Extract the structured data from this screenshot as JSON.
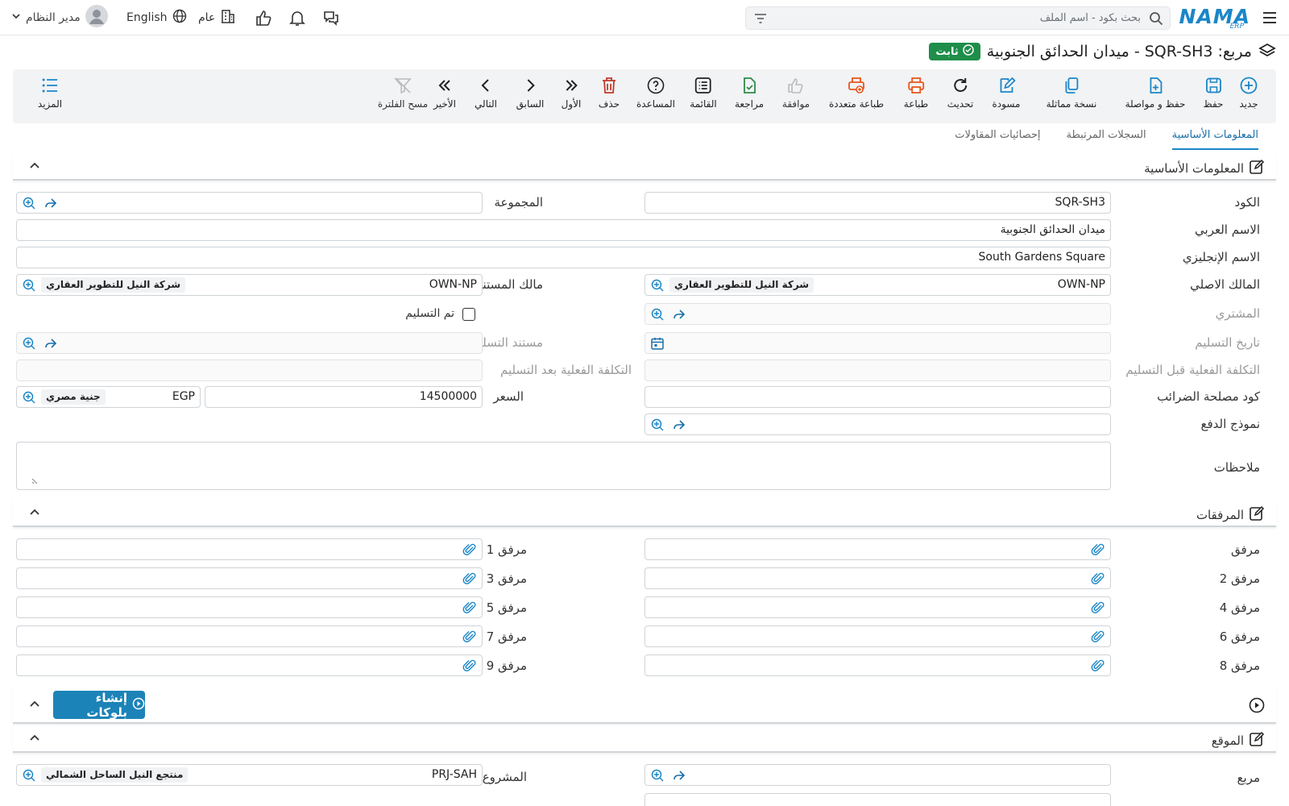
{
  "topbar": {
    "search_placeholder": "بحث بكود - اسم الملف",
    "logo_main": "NAMA",
    "logo_sub": "ERP",
    "user_name": "مدير النظام",
    "language": "English",
    "branch": "عام"
  },
  "header": {
    "title": "مربع: SQR-SH3 - ميدان الحدائق الجنوبية",
    "status": "ثابت"
  },
  "toolbar": {
    "new": "جديد",
    "save": "حفظ",
    "save_continue": "حفظ و مواصلة",
    "duplicate": "نسخة مماثلة",
    "draft": "مسودة",
    "refresh": "تحديث",
    "print": "طباعة",
    "multi_print": "طباعة متعددة",
    "approve": "موافقة",
    "review": "مراجعة",
    "list": "القائمة",
    "help": "المساعدة",
    "delete": "حذف",
    "first": "الأول",
    "previous": "السابق",
    "next": "التالي",
    "last": "الأخير",
    "clear_filter": "مسح الفلترة",
    "more": "المزيد"
  },
  "tabs": [
    "المعلومات الأساسية",
    "السجلات المرتبطة",
    "إحصائيات المقاولات"
  ],
  "sections": {
    "basic": "المعلومات الأساسية",
    "attachments": "المرفقات",
    "blocks_button": "إنشاء بلوكات",
    "location": "الموقع"
  },
  "form": {
    "code_label": "الكود",
    "code_value": "SQR-SH3",
    "group_label": "المجموعة",
    "arabic_name_label": "الاسم العربي",
    "arabic_name_value": "ميدان الحدائق الجنوبية",
    "english_name_label": "الاسم الإنجليزي",
    "english_name_value": "South Gardens Square",
    "original_owner_label": "المالك الاصلي",
    "original_owner_code": "OWN-NP",
    "original_owner_name": "شركة النيل للتطوير العقاري",
    "doc_owner_label": "مالك المستند",
    "doc_owner_code": "OWN-NP",
    "doc_owner_name": "شركة النيل للتطوير العقاري",
    "buyer_label": "المشتري",
    "delivered_label": "تم التسليم",
    "delivery_date_label": "تاريخ التسليم",
    "delivery_doc_label": "مستند التسليم",
    "cost_before_label": "التكلفة الفعلية قبل التسليم",
    "cost_after_label": "التكلفة الفعلية بعد التسليم",
    "tax_code_label": "كود مصلحة الضرائب",
    "price_label": "السعر",
    "price_value": "14500000",
    "currency_code": "EGP",
    "currency_name": "جنية مصري",
    "payment_model_label": "نموذج الدفع",
    "notes_label": "ملاحظات"
  },
  "attachments": {
    "a0": "مرفق",
    "a1": "مرفق 1",
    "a2": "مرفق 2",
    "a3": "مرفق 3",
    "a4": "مرفق 4",
    "a5": "مرفق 5",
    "a6": "مرفق 6",
    "a7": "مرفق 7",
    "a8": "مرفق 8",
    "a9": "مرفق 9"
  },
  "location": {
    "square_label": "مربع",
    "project_label": "المشروع",
    "project_code": "PRJ-SAH",
    "project_name": "منتجع النيل الساحل الشمالي"
  },
  "colors": {
    "accent": "#1a86c8",
    "status_green": "#1e8e4a",
    "print_orange": "#e8541c",
    "delete_red": "#c0392b",
    "review_green": "#2e8b4a"
  }
}
